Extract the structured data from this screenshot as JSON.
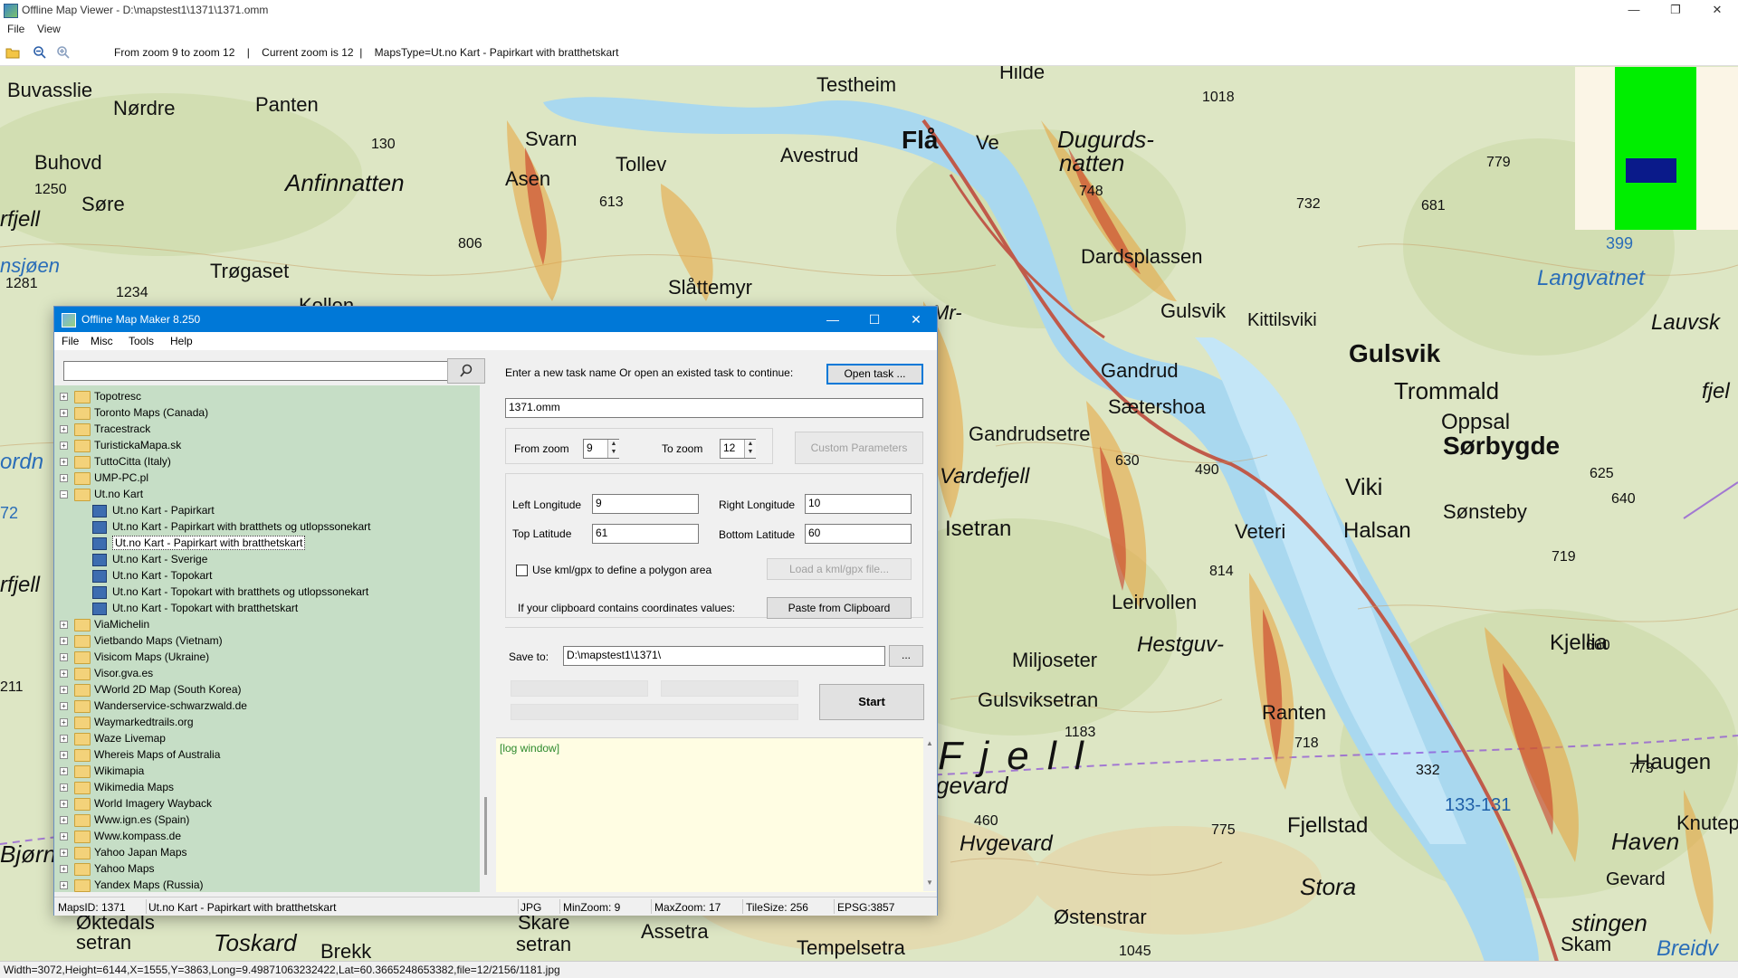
{
  "app": {
    "title": "Offline Map Viewer - D:\\mapstest1\\1371\\1371.omm",
    "menu": [
      "File",
      "View"
    ],
    "toolbar_info": "From zoom 9 to zoom 12    |    Current zoom is 12  |    MapsType=Ut.no Kart - Papirkart with bratthetskart",
    "window_buttons": {
      "minimize": "—",
      "maximize": "❐",
      "close": "✕"
    }
  },
  "map": {
    "labels": [
      "Buvasslie",
      "Nørdre",
      "Panten",
      "Buhovd",
      "Søre",
      "rfjell",
      "Anfinnatten",
      "Svarn",
      "Tollev",
      "Asen",
      "Avestrud",
      "Flå",
      "Ve",
      "Dugurds-",
      "natten",
      "Hilde",
      "Testheim",
      "1018",
      "779",
      "681",
      "732",
      "748",
      "Trøgaset",
      "806",
      "1250",
      "1281",
      "1234",
      "130",
      "613",
      "Slåttemyr",
      "Kollen",
      "nsjøen",
      "Gulsvik",
      "Kittilsviki",
      "Gulsvik",
      "Trommald",
      "Oppsal",
      "Sørbygde",
      "Gandrud",
      "Sætershoa",
      "Gandrudsetre",
      "Dardsplassen",
      "Langvatnet",
      "Lauvsk",
      "fjel",
      "Viki",
      "Halsan",
      "Sønsteby",
      "Vardefjell",
      "Isetran",
      "Veteri",
      "490",
      "625",
      "640",
      "719",
      "630",
      "814",
      "Leirvollen",
      "Hestguv-",
      "Miljoseter",
      "Gulsviksetran",
      "Ranten",
      "Kjellia",
      "660",
      "rfjell",
      "ordn",
      "72",
      "211",
      "1183",
      "718",
      "775",
      "332",
      "773",
      "Haugen",
      "133-131",
      "Knutepla",
      "Haven",
      "Hvgevard",
      "Fjellstad",
      "Stora",
      "Østenstrar",
      "1045",
      "stingen",
      "Toskard",
      "Brekk",
      "Skare",
      "setran",
      "Assetra",
      "Tempelsetra",
      "Øktedals",
      "setran",
      "Breidv",
      "Bjørn",
      "460",
      "gevard",
      "Skam",
      "Gevard",
      "Mr-",
      "399",
      "F j e l l"
    ],
    "overview": {
      "green": "#00ee00",
      "blue": "#0a1a8a"
    },
    "status": "Width=3072,Height=6144,X=1555,Y=3863,Long=9.49871063232422,Lat=60.3665248653382,file=12/2156/1181.jpg"
  },
  "dialog": {
    "title": "Offline Map Maker 8.250",
    "menu": [
      "File",
      "Misc",
      "Tools",
      "Help"
    ],
    "search": {
      "value": "",
      "icon": "search-icon"
    },
    "tree": [
      {
        "label": "Topotresc",
        "type": "folder",
        "level": 0
      },
      {
        "label": "Toronto Maps (Canada)",
        "type": "folder",
        "level": 0
      },
      {
        "label": "Tracestrack",
        "type": "folder",
        "level": 0
      },
      {
        "label": "TuristickaMapa.sk",
        "type": "folder",
        "level": 0
      },
      {
        "label": "TuttoCitta (Italy)",
        "type": "folder",
        "level": 0
      },
      {
        "label": "UMP-PC.pl",
        "type": "folder",
        "level": 0
      },
      {
        "label": "Ut.no Kart",
        "type": "folder-open",
        "level": 0
      },
      {
        "label": "Ut.no Kart - Papirkart",
        "type": "map",
        "level": 1
      },
      {
        "label": "Ut.no Kart - Papirkart with bratthets og utlopssonekart",
        "type": "map",
        "level": 1
      },
      {
        "label": "Ut.no Kart - Papirkart with bratthetskart",
        "type": "map",
        "level": 1,
        "selected": true
      },
      {
        "label": "Ut.no Kart - Sverige",
        "type": "map",
        "level": 1
      },
      {
        "label": "Ut.no Kart - Topokart",
        "type": "map",
        "level": 1
      },
      {
        "label": "Ut.no Kart - Topokart with bratthets og utlopssonekart",
        "type": "map",
        "level": 1
      },
      {
        "label": "Ut.no Kart - Topokart with bratthetskart",
        "type": "map",
        "level": 1
      },
      {
        "label": "ViaMichelin",
        "type": "folder",
        "level": 0
      },
      {
        "label": "Vietbando Maps (Vietnam)",
        "type": "folder",
        "level": 0
      },
      {
        "label": "Visicom Maps (Ukraine)",
        "type": "folder",
        "level": 0
      },
      {
        "label": "Visor.gva.es",
        "type": "folder",
        "level": 0
      },
      {
        "label": "VWorld 2D Map (South Korea)",
        "type": "folder",
        "level": 0
      },
      {
        "label": "Wanderservice-schwarzwald.de",
        "type": "folder",
        "level": 0
      },
      {
        "label": "Waymarkedtrails.org",
        "type": "folder",
        "level": 0
      },
      {
        "label": "Waze Livemap",
        "type": "folder",
        "level": 0
      },
      {
        "label": "Whereis Maps of Australia",
        "type": "folder",
        "level": 0
      },
      {
        "label": "Wikimapia",
        "type": "folder",
        "level": 0
      },
      {
        "label": "Wikimedia Maps",
        "type": "folder",
        "level": 0
      },
      {
        "label": "World Imagery Wayback",
        "type": "folder",
        "level": 0
      },
      {
        "label": "Www.ign.es (Spain)",
        "type": "folder",
        "level": 0
      },
      {
        "label": "Www.kompass.de",
        "type": "folder",
        "level": 0
      },
      {
        "label": "Yahoo Japan Maps",
        "type": "folder",
        "level": 0
      },
      {
        "label": "Yahoo Maps",
        "type": "folder",
        "level": 0
      },
      {
        "label": "Yandex Maps (Russia)",
        "type": "folder",
        "level": 0
      }
    ],
    "task_prompt": "Enter a new task name Or open an existed task to continue:",
    "open_task_button": "Open task ...",
    "task_name": "1371.omm",
    "from_zoom_label": "From zoom",
    "from_zoom_value": "9",
    "to_zoom_label": "To zoom",
    "to_zoom_value": "12",
    "custom_params_button": "Custom Parameters",
    "left_lon_label": "Left Longitude",
    "left_lon_value": "9",
    "right_lon_label": "Right Longitude",
    "right_lon_value": "10",
    "top_lat_label": "Top Latitude",
    "top_lat_value": "61",
    "bottom_lat_label": "Bottom Latitude",
    "bottom_lat_value": "60",
    "kml_checkbox_label": "Use kml/gpx to define a polygon area",
    "kml_checked": false,
    "load_kml_button": "Load a kml/gpx file...",
    "clipboard_label": "If your clipboard contains coordinates values:",
    "paste_button": "Paste from Clipboard",
    "save_to_label": "Save to:",
    "save_to_value": "D:\\mapstest1\\1371\\",
    "browse_button": "...",
    "start_button": "Start",
    "log_text": "[log window]",
    "status": {
      "maps_id": "MapsID: 1371",
      "map_name": "Ut.no Kart - Papirkart with bratthetskart",
      "format": "JPG",
      "min_zoom": "MinZoom: 9",
      "max_zoom": "MaxZoom: 17",
      "tile_size": "TileSize: 256",
      "epsg": "EPSG:3857"
    }
  }
}
